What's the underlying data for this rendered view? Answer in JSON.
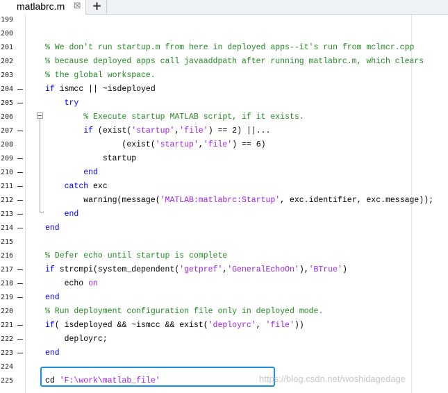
{
  "tab": {
    "title": "matlabrc.m",
    "close_glyph": "⊠",
    "add_glyph": "+"
  },
  "watermark": "https://blog.csdn.net/woshidagedage",
  "lines": [
    {
      "n": "199",
      "segs": []
    },
    {
      "n": "200",
      "segs": []
    },
    {
      "n": "201",
      "segs": [
        {
          "t": "% We don't run startup.m from here in deployed apps--it's run from mclmcr.cpp",
          "c": "cmt"
        }
      ]
    },
    {
      "n": "202",
      "segs": [
        {
          "t": "% because deployed apps call javaaddpath after running matlabrc.m, which clears",
          "c": "cmt"
        }
      ]
    },
    {
      "n": "203",
      "segs": [
        {
          "t": "% the global workspace.",
          "c": "cmt"
        }
      ]
    },
    {
      "n": "204",
      "mark": true,
      "segs": [
        {
          "t": "if",
          "c": "kw"
        },
        {
          "t": " ismcc || ~isdeployed",
          "c": ""
        }
      ]
    },
    {
      "n": "205",
      "mark": true,
      "segs": [
        {
          "t": "    ",
          "c": ""
        },
        {
          "t": "try",
          "c": "kw"
        }
      ]
    },
    {
      "n": "206",
      "segs": [
        {
          "t": "        ",
          "c": ""
        },
        {
          "t": "% Execute startup MATLAB script, if it exists.",
          "c": "cmt"
        }
      ]
    },
    {
      "n": "207",
      "mark": true,
      "segs": [
        {
          "t": "        ",
          "c": ""
        },
        {
          "t": "if",
          "c": "kw"
        },
        {
          "t": " (exist(",
          "c": ""
        },
        {
          "t": "'startup'",
          "c": "str"
        },
        {
          "t": ",",
          "c": ""
        },
        {
          "t": "'file'",
          "c": "str"
        },
        {
          "t": ") == 2) ||...",
          "c": ""
        }
      ]
    },
    {
      "n": "208",
      "segs": [
        {
          "t": "                (exist(",
          "c": ""
        },
        {
          "t": "'startup'",
          "c": "str"
        },
        {
          "t": ",",
          "c": ""
        },
        {
          "t": "'file'",
          "c": "str"
        },
        {
          "t": ") == 6)",
          "c": ""
        }
      ]
    },
    {
      "n": "209",
      "mark": true,
      "segs": [
        {
          "t": "            startup",
          "c": ""
        }
      ]
    },
    {
      "n": "210",
      "mark": true,
      "segs": [
        {
          "t": "        ",
          "c": ""
        },
        {
          "t": "end",
          "c": "kw"
        }
      ]
    },
    {
      "n": "211",
      "mark": true,
      "segs": [
        {
          "t": "    ",
          "c": ""
        },
        {
          "t": "catch",
          "c": "kw"
        },
        {
          "t": " exc",
          "c": ""
        }
      ]
    },
    {
      "n": "212",
      "mark": true,
      "segs": [
        {
          "t": "        warning(message(",
          "c": ""
        },
        {
          "t": "'MATLAB:matlabrc:Startup'",
          "c": "str"
        },
        {
          "t": ", exc.identifier, exc.message));",
          "c": ""
        }
      ]
    },
    {
      "n": "213",
      "mark": true,
      "segs": [
        {
          "t": "    ",
          "c": ""
        },
        {
          "t": "end",
          "c": "kw"
        }
      ]
    },
    {
      "n": "214",
      "mark": true,
      "segs": [
        {
          "t": "end",
          "c": "kw"
        }
      ]
    },
    {
      "n": "215",
      "segs": []
    },
    {
      "n": "216",
      "segs": [
        {
          "t": "% Defer echo until startup is complete",
          "c": "cmt"
        }
      ]
    },
    {
      "n": "217",
      "mark": true,
      "segs": [
        {
          "t": "if",
          "c": "kw"
        },
        {
          "t": " strcmpi(system_dependent(",
          "c": ""
        },
        {
          "t": "'getpref'",
          "c": "str"
        },
        {
          "t": ",",
          "c": ""
        },
        {
          "t": "'GeneralEchoOn'",
          "c": "str"
        },
        {
          "t": "),",
          "c": ""
        },
        {
          "t": "'BTrue'",
          "c": "str"
        },
        {
          "t": ")",
          "c": ""
        }
      ]
    },
    {
      "n": "218",
      "mark": true,
      "segs": [
        {
          "t": "    echo ",
          "c": ""
        },
        {
          "t": "on",
          "c": "str"
        }
      ]
    },
    {
      "n": "219",
      "mark": true,
      "segs": [
        {
          "t": "end",
          "c": "kw"
        }
      ]
    },
    {
      "n": "220",
      "segs": [
        {
          "t": "% Run deployment configuration file only in deployed mode.",
          "c": "cmt"
        }
      ]
    },
    {
      "n": "221",
      "mark": true,
      "segs": [
        {
          "t": "if",
          "c": "kw"
        },
        {
          "t": "( isdeployed && ~ismcc && exist(",
          "c": ""
        },
        {
          "t": "'deployrc'",
          "c": "str"
        },
        {
          "t": ", ",
          "c": ""
        },
        {
          "t": "'file'",
          "c": "str"
        },
        {
          "t": "))",
          "c": ""
        }
      ]
    },
    {
      "n": "222",
      "mark": true,
      "segs": [
        {
          "t": "    deployrc;",
          "c": ""
        }
      ]
    },
    {
      "n": "223",
      "mark": true,
      "segs": [
        {
          "t": "end",
          "c": "kw"
        }
      ]
    },
    {
      "n": "224",
      "segs": []
    },
    {
      "n": "225",
      "segs": [
        {
          "t": "cd ",
          "c": ""
        },
        {
          "t": "'F:\\work\\matlab_file'",
          "c": "str"
        }
      ]
    }
  ]
}
